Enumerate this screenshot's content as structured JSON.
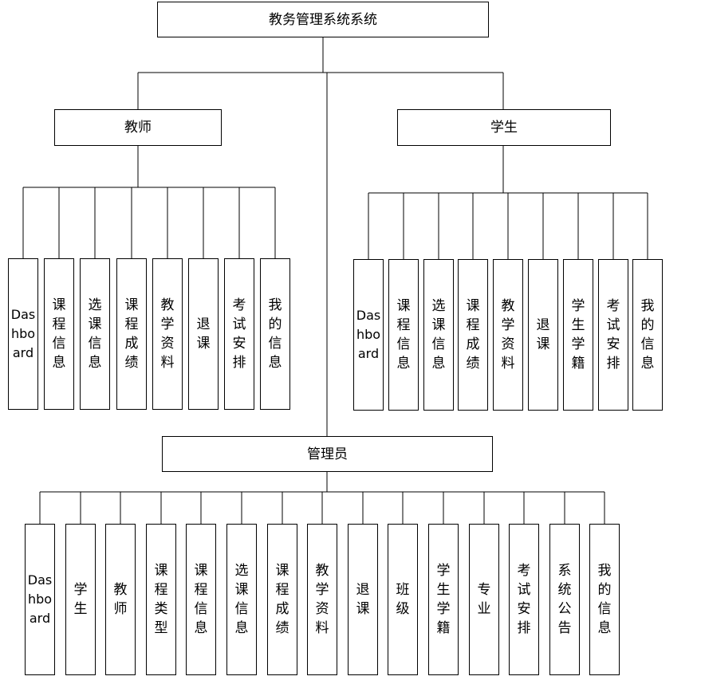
{
  "root": "教务管理系统系统",
  "teacher": {
    "title": "教师",
    "items": [
      "Dashboard",
      "课程信息",
      "选课信息",
      "课程成绩",
      "教学资料",
      "退课",
      "考试安排",
      "我的信息"
    ]
  },
  "student": {
    "title": "学生",
    "items": [
      "Dashboard",
      "课程信息",
      "选课信息",
      "课程成绩",
      "教学资料",
      "退课",
      "学生学籍",
      "考试安排",
      "我的信息"
    ]
  },
  "admin": {
    "title": "管理员",
    "items": [
      "Dashboard",
      "学生",
      "教师",
      "课程类型",
      "课程信息",
      "选课信息",
      "课程成绩",
      "教学资料",
      "退课",
      "班级",
      "学生学籍",
      "专业",
      "考试安排",
      "系统公告",
      "我的信息"
    ]
  }
}
